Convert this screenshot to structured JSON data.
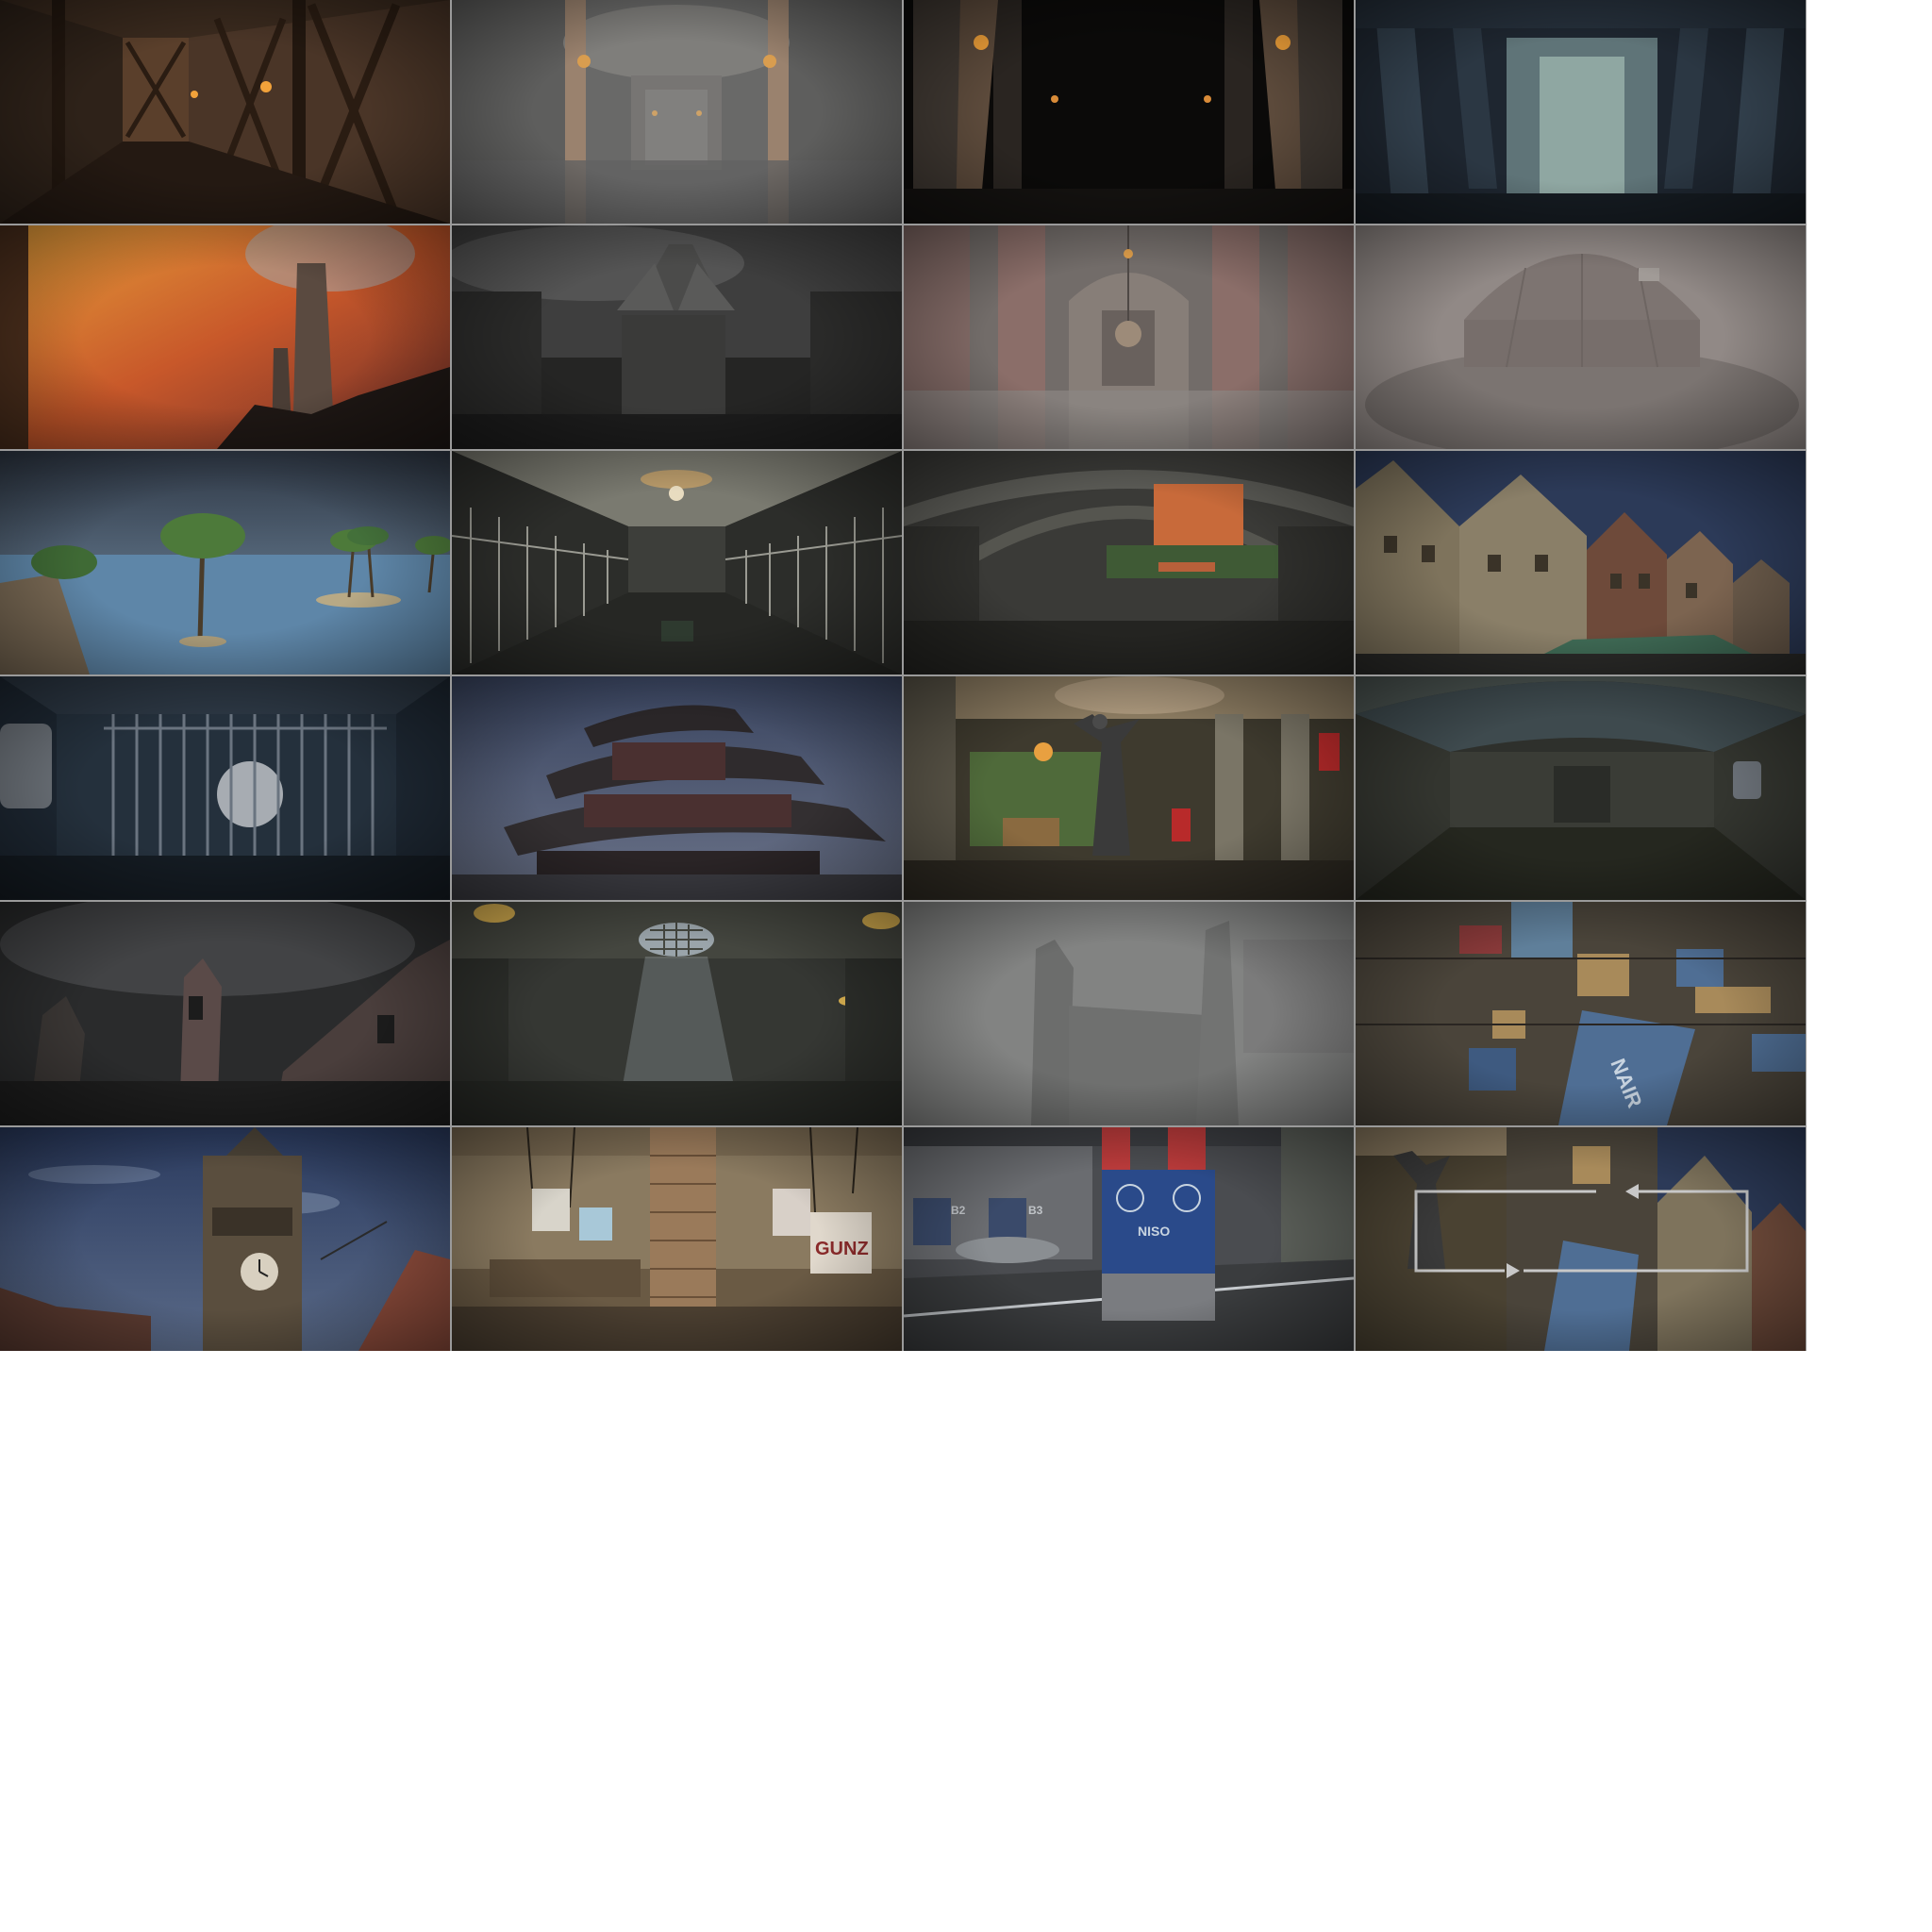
{
  "sheet": {
    "columns": 4,
    "rows": 6,
    "border_color": "#9a9a9a",
    "background": "#ffffff"
  },
  "thumbnails": [
    {
      "scene": "timber-corridor-torches"
    },
    {
      "scene": "stone-hall-torches-fog"
    },
    {
      "scene": "dark-pillared-hall"
    },
    {
      "scene": "blue-pillar-hall"
    },
    {
      "scene": "fiery-sky-chimneys"
    },
    {
      "scene": "dragon-statue-fortress"
    },
    {
      "scene": "marble-hall-chandelier"
    },
    {
      "scene": "domed-building-fog"
    },
    {
      "scene": "palm-island-sea"
    },
    {
      "scene": "prison-cell-corridor"
    },
    {
      "scene": "stone-arena-arches"
    },
    {
      "scene": "medieval-town-houses"
    },
    {
      "scene": "sewer-bars-moonlight"
    },
    {
      "scene": "pagoda-temple-sky"
    },
    {
      "scene": "cathedral-statue-hall"
    },
    {
      "scene": "stone-tunnel-vault"
    },
    {
      "scene": "ruined-castle-storm"
    },
    {
      "scene": "skylight-grate-hall"
    },
    {
      "scene": "foggy-ruined-tower"
    },
    {
      "scene": "container-port-yard"
    },
    {
      "scene": "clock-tower-town"
    },
    {
      "scene": "wooden-warehouse-posters",
      "poster_text": "GUNZ"
    },
    {
      "scene": "hangar-crate",
      "crate_text": "NISO",
      "bay_labels": [
        "B2",
        "B3"
      ]
    },
    {
      "scene": "collage-with-arrows",
      "container_text": "NAIR"
    }
  ],
  "colors": {
    "torch": "#f2a23a",
    "fog": "#8f8f8f",
    "sky_blue": "#4a5874",
    "fire": "#d36a2a",
    "sea": "#5e86a8",
    "container_blue": "#4f6e94",
    "arrow": "#c8c8c8"
  }
}
